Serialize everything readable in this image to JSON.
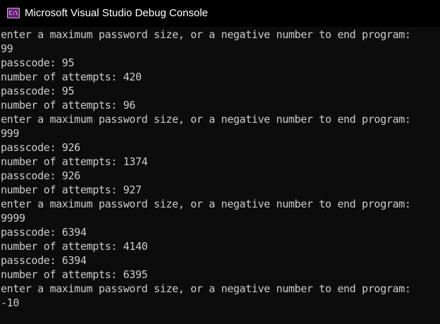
{
  "window": {
    "title": "Microsoft Visual Studio Debug Console",
    "icon": "C:\\",
    "icon_name": "vs-console-icon",
    "accent_color": "#68217a"
  },
  "console": {
    "lines": [
      "enter a maximum password size, or a negative number to end program:",
      "99",
      "passcode: 95",
      "number of attempts: 420",
      "passcode: 95",
      "number of attempts: 96",
      "enter a maximum password size, or a negative number to end program:",
      "999",
      "passcode: 926",
      "number of attempts: 1374",
      "passcode: 926",
      "number of attempts: 927",
      "enter a maximum password size, or a negative number to end program:",
      "9999",
      "passcode: 6394",
      "number of attempts: 4140",
      "passcode: 6394",
      "number of attempts: 6395",
      "enter a maximum password size, or a negative number to end program:",
      "-10"
    ]
  }
}
